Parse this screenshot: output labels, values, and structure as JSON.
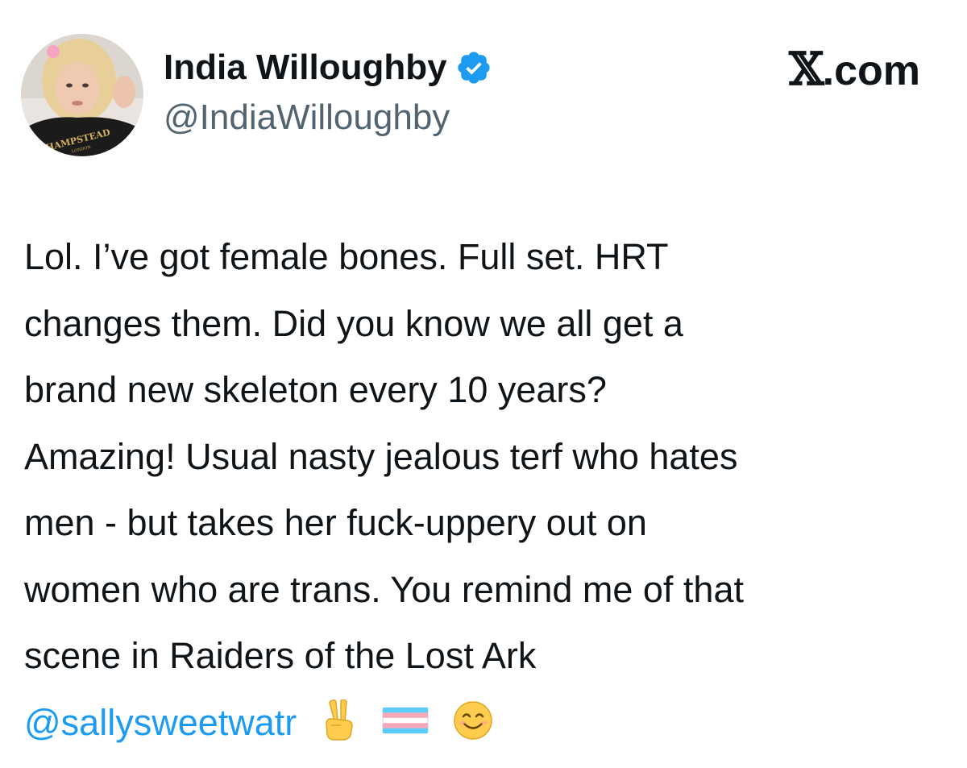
{
  "author": {
    "display_name": "India Willoughby",
    "handle": "@IndiaWilloughby",
    "verified": true,
    "avatar_shirt_text": "HAMPSTEAD",
    "avatar_shirt_subtext": "LONDON"
  },
  "brand": {
    "logo_letter": "𝕏",
    "domain": ".com"
  },
  "tweet": {
    "lines": [
      "Lol. I’ve got female bones. Full set. HRT",
      "changes them. Did you know we all get a",
      "brand new skeleton every 10 years?",
      "Amazing! Usual nasty jealous terf who hates",
      "men - but takes her fuck-uppery out on",
      "women who are trans. You remind me of that",
      "scene in Raiders of the Lost Ark"
    ],
    "mention": "@sallysweetwatr",
    "emojis": [
      "victory-hand-emoji",
      "transgender-flag-emoji",
      "smiling-face-emoji"
    ]
  },
  "colors": {
    "text": "#0f1419",
    "secondary": "#536471",
    "link": "#1d9bf0",
    "verified": "#1d9bf0",
    "trans_blue": "#5bcefa",
    "trans_pink": "#f5a9b8"
  }
}
